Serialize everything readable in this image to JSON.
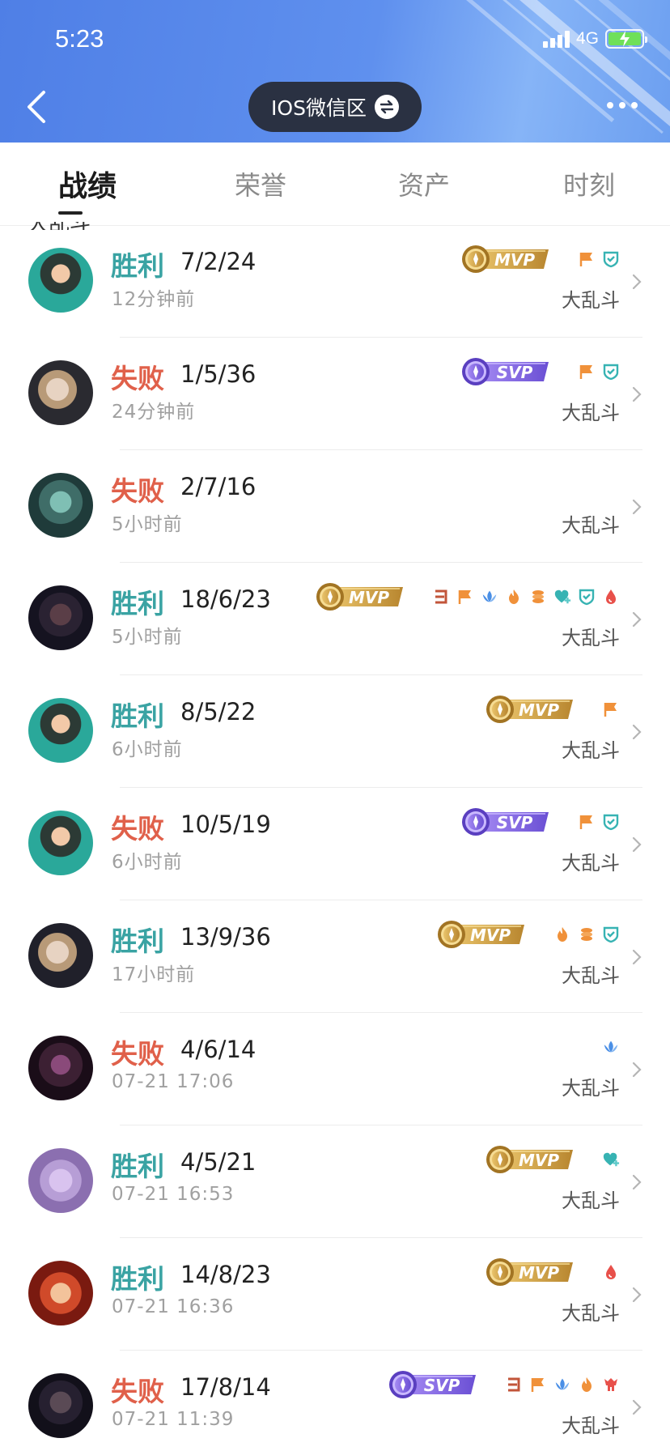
{
  "status_bar": {
    "time": "5:23",
    "network": "4G"
  },
  "header": {
    "server_label": "IOS微信区"
  },
  "tabs": [
    {
      "label": "战绩"
    },
    {
      "label": "荣誉"
    },
    {
      "label": "资产"
    },
    {
      "label": "时刻"
    }
  ],
  "section_label": "大乱斗",
  "matches": [
    {
      "result": "胜利",
      "kda": "7/2/24",
      "time": "12分钟前",
      "mode": "大乱斗",
      "badge": "MVP",
      "honors": [
        "flag-icon",
        "shield-icon"
      ]
    },
    {
      "result": "失败",
      "kda": "1/5/36",
      "time": "24分钟前",
      "mode": "大乱斗",
      "badge": "SVP",
      "honors": [
        "flag-icon",
        "shield-icon"
      ]
    },
    {
      "result": "失败",
      "kda": "2/7/16",
      "time": "5小时前",
      "mode": "大乱斗",
      "badge": "",
      "honors": []
    },
    {
      "result": "胜利",
      "kda": "18/6/23",
      "time": "5小时前",
      "mode": "大乱斗",
      "badge": "MVP",
      "honors": [
        "triple-kill-icon",
        "flag-icon",
        "lotus-icon",
        "fire-icon",
        "coins-icon",
        "heal-icon",
        "shield-icon",
        "drop-icon"
      ]
    },
    {
      "result": "胜利",
      "kda": "8/5/22",
      "time": "6小时前",
      "mode": "大乱斗",
      "badge": "MVP",
      "honors": [
        "flag-icon"
      ]
    },
    {
      "result": "失败",
      "kda": "10/5/19",
      "time": "6小时前",
      "mode": "大乱斗",
      "badge": "SVP",
      "honors": [
        "flag-icon",
        "shield-icon"
      ]
    },
    {
      "result": "胜利",
      "kda": "13/9/36",
      "time": "17小时前",
      "mode": "大乱斗",
      "badge": "MVP",
      "honors": [
        "fire-icon",
        "coins-icon",
        "shield-icon"
      ]
    },
    {
      "result": "失败",
      "kda": "4/6/14",
      "time": "07-21 17:06",
      "mode": "大乱斗",
      "badge": "",
      "honors": [
        "lotus-icon"
      ]
    },
    {
      "result": "胜利",
      "kda": "4/5/21",
      "time": "07-21 16:53",
      "mode": "大乱斗",
      "badge": "MVP",
      "honors": [
        "heal-icon"
      ]
    },
    {
      "result": "胜利",
      "kda": "14/8/23",
      "time": "07-21 16:36",
      "mode": "大乱斗",
      "badge": "MVP",
      "honors": [
        "drop-icon"
      ]
    },
    {
      "result": "失败",
      "kda": "17/8/14",
      "time": "07-21 11:39",
      "mode": "大乱斗",
      "badge": "SVP",
      "honors": [
        "triple-kill-icon",
        "flag-icon",
        "lotus-icon",
        "fire-icon",
        "tower-icon"
      ]
    }
  ],
  "colors": {
    "win": "#3aa3a3",
    "lose": "#e0604a",
    "header": "#5f90ee",
    "mvp_gold": "#d9a844",
    "svp_purple": "#8a67e0"
  }
}
